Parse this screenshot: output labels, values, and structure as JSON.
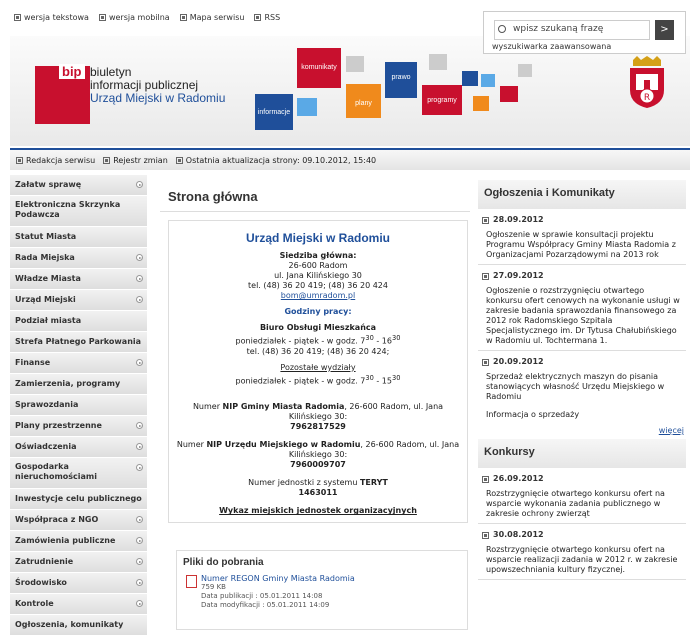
{
  "top_links": [
    "wersja tekstowa",
    "wersja mobilna",
    "Mapa serwisu",
    "RSS"
  ],
  "search": {
    "placeholder": "wpisz szukaną frazę",
    "button": ">",
    "advanced": "wyszukiwarka zaawansowana"
  },
  "logo": {
    "mark": "bip",
    "line1": "biuletyn",
    "line2": "informacji publicznej",
    "line3": "Urząd Miejski w Radomiu"
  },
  "bubbles": [
    "komunikaty",
    "prawo",
    "plany",
    "programy",
    "informacje"
  ],
  "navbar": {
    "items": [
      "Redakcja serwisu",
      "Rejestr zmian",
      "Ostatnia aktualizacja strony: 09.10.2012, 15:40"
    ]
  },
  "sidebar": {
    "items": [
      {
        "label": "Załatw sprawę",
        "arrow": true
      },
      {
        "label": "Elektroniczna Skrzynka Podawcza",
        "arrow": false,
        "dbl": true
      },
      {
        "label": "Statut Miasta",
        "arrow": false
      },
      {
        "label": "Rada Miejska",
        "arrow": true
      },
      {
        "label": "Władze Miasta",
        "arrow": true
      },
      {
        "label": "Urząd Miejski",
        "arrow": true
      },
      {
        "label": "Podział miasta",
        "arrow": false
      },
      {
        "label": "Strefa Płatnego Parkowania",
        "arrow": false
      },
      {
        "label": "Finanse",
        "arrow": true
      },
      {
        "label": "Zamierzenia, programy",
        "arrow": false
      },
      {
        "label": "Sprawozdania",
        "arrow": false
      },
      {
        "label": "Plany przestrzenne",
        "arrow": true
      },
      {
        "label": "Oświadczenia",
        "arrow": true
      },
      {
        "label": "Gospodarka nieruchomościami",
        "arrow": true,
        "dbl": true
      },
      {
        "label": "Inwestycje celu publicznego",
        "arrow": false
      },
      {
        "label": "Współpraca z NGO",
        "arrow": true
      },
      {
        "label": "Zamówienia publiczne",
        "arrow": true
      },
      {
        "label": "Zatrudnienie",
        "arrow": true
      },
      {
        "label": "Środowisko",
        "arrow": true
      },
      {
        "label": "Kontrole",
        "arrow": true
      },
      {
        "label": "Ogłoszenia, komunikaty",
        "arrow": false
      }
    ]
  },
  "main": {
    "title": "Strona główna",
    "card_title": "Urząd Miejski w Radomiu",
    "hq_label": "Siedziba główna:",
    "hq_city": "26-600 Radom",
    "hq_street": "ul. Jana Kilińskiego 30",
    "hq_tel": "tel. (48) 36 20 419; (48) 36 20 424",
    "hq_email": "bom@umradom.pl",
    "hours_label": "Godziny pracy:",
    "bom_label": "Biuro Obsługi Mieszkańca",
    "bom_hours_prefix": "poniedziałek - piątek - w godz. 7",
    "bom_h1": "30",
    "bom_dash": " - 16",
    "bom_h2": "30",
    "bom_tel": "tel. (48) 36 20 419; (48) 36 20 424;",
    "other_label": "Pozostałe wydziały",
    "other_hours_prefix": "poniedziałek - piątek - w godz. 7",
    "other_h1": "30",
    "other_dash": " - 15",
    "other_h2": "30",
    "nip1_pre": "Numer ",
    "nip1_bold": "NIP Gminy Miasta Radomia",
    "nip1_post": ", 26-600 Radom, ul. Jana Kilińskiego 30:",
    "nip1_val": "7962817529",
    "nip2_pre": "Numer ",
    "nip2_bold": "NIP Urzędu Miejskiego w Radomiu",
    "nip2_post": ", 26-600 Radom, ul. Jana Kilińskiego 30:",
    "nip2_val": "7960009707",
    "teryt_pre": "Numer jednostki z systemu ",
    "teryt_bold": "TERYT",
    "teryt_val": "1463011",
    "units_link": "Wykaz miejskich jednostek organizacyjnych",
    "files_title": "Pliki do pobrania",
    "file": {
      "name": "Numer REGON Gminy Miasta Radomia",
      "size": "759 KB",
      "published": "Data publikacji : 05.01.2011 14:08",
      "modified": "Data modyfikacji : 05.01.2011 14:09"
    }
  },
  "right": {
    "announcements_title": "Ogłoszenia i Komunikaty",
    "news": [
      {
        "date": "28.09.2012",
        "text": "Ogłoszenie w sprawie konsultacji projektu Programu Współpracy Gminy Miasta Radomia z Organizacjami Pozarządowymi na 2013 rok"
      },
      {
        "date": "27.09.2012",
        "text": "Ogłoszenie o rozstrzygnięciu otwartego konkursu ofert cenowych na wykonanie usługi w zakresie badania sprawozdania finansowego za 2012 rok Radomskiego Szpitala Specjalistycznego im. Dr Tytusa Chałubińskiego w Radomiu ul. Tochtermana 1."
      },
      {
        "date": "20.09.2012",
        "text": "Sprzedaż elektrycznych maszyn do pisania stanowiących własność Urzędu Miejskiego w Radomiu",
        "extra": "Informacja o sprzedaży"
      }
    ],
    "more": "więcej",
    "contests_title": "Konkursy",
    "contests": [
      {
        "date": "26.09.2012",
        "text": "Rozstrzygnięcie otwartego konkursu ofert na wsparcie wykonania zadania publicznego w zakresie ochrony zwierząt"
      },
      {
        "date": "30.08.2012",
        "text": "Rozstrzygnięcie otwartego konkursu ofert na wsparcie realizacji zadania w 2012 r. w zakresie upowszechniania kultury fizycznej."
      }
    ]
  }
}
